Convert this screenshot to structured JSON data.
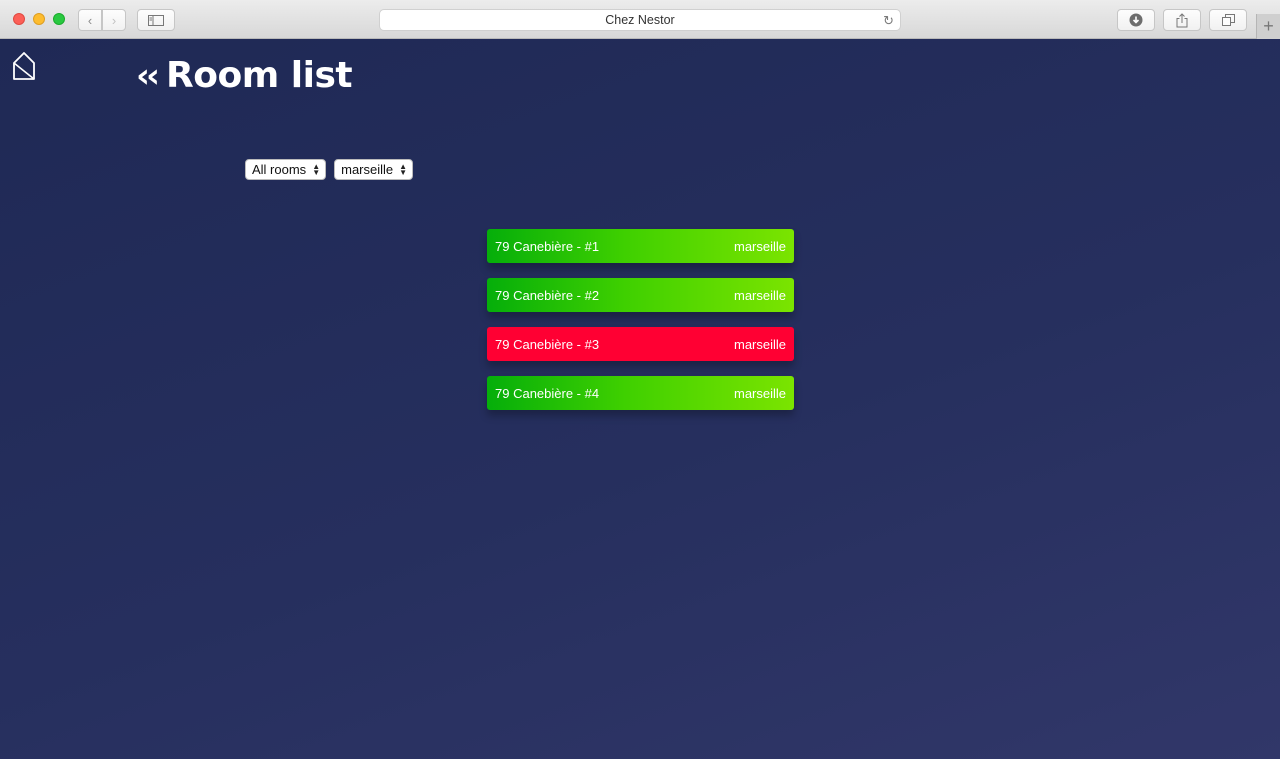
{
  "browser": {
    "url_title": "Chez Nestor"
  },
  "page": {
    "back_icon": "chevrons-left-icon",
    "title": "Room list",
    "filters": {
      "type_value": "All rooms",
      "city_value": "marseille"
    },
    "rooms": [
      {
        "name": "79 Canebière - #1",
        "city": "marseille",
        "status": "available"
      },
      {
        "name": "79 Canebière - #2",
        "city": "marseille",
        "status": "available"
      },
      {
        "name": "79 Canebière - #3",
        "city": "marseille",
        "status": "occupied"
      },
      {
        "name": "79 Canebière - #4",
        "city": "marseille",
        "status": "available"
      }
    ],
    "colors": {
      "available_start": "#05ae0a",
      "available_end": "#7be400",
      "occupied": "#ff0033",
      "background": "#232d58"
    }
  }
}
